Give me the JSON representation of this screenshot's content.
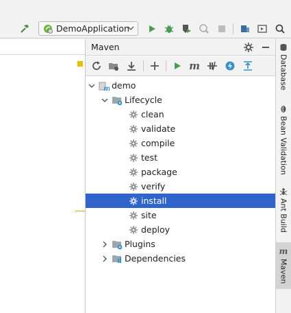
{
  "toolbar": {
    "run_config_label": "DemoApplication",
    "icons": [
      "hammer-icon",
      "spring-boot-icon",
      "run-icon",
      "debug-icon",
      "coverage-icon",
      "profiler-icon",
      "stop-icon",
      "project-structure-icon",
      "run-anything-icon",
      "search-icon"
    ]
  },
  "maven_panel": {
    "title": "Maven",
    "header_icons": [
      "gear-icon",
      "minimize-icon"
    ],
    "toolbar_icons": [
      "reload-icon",
      "generate-sources-icon",
      "download-icon",
      "add-icon",
      "run-icon",
      "execute-goal-icon",
      "toggle-offline-icon",
      "skip-tests-icon",
      "show-dependencies-icon"
    ],
    "tree": {
      "root": "demo",
      "lifecycle_label": "Lifecycle",
      "goals": [
        "clean",
        "validate",
        "compile",
        "test",
        "package",
        "verify",
        "install",
        "site",
        "deploy"
      ],
      "selected_goal": "install",
      "plugins_label": "Plugins",
      "dependencies_label": "Dependencies"
    }
  },
  "right_sidebar": {
    "tabs": [
      "Database",
      "Bean Validation",
      "Ant Build",
      "Maven"
    ],
    "active_tab": "Maven"
  },
  "colors": {
    "selection": "#2f65ca",
    "run_green": "#499c54",
    "maven_blue": "#3592c4"
  }
}
